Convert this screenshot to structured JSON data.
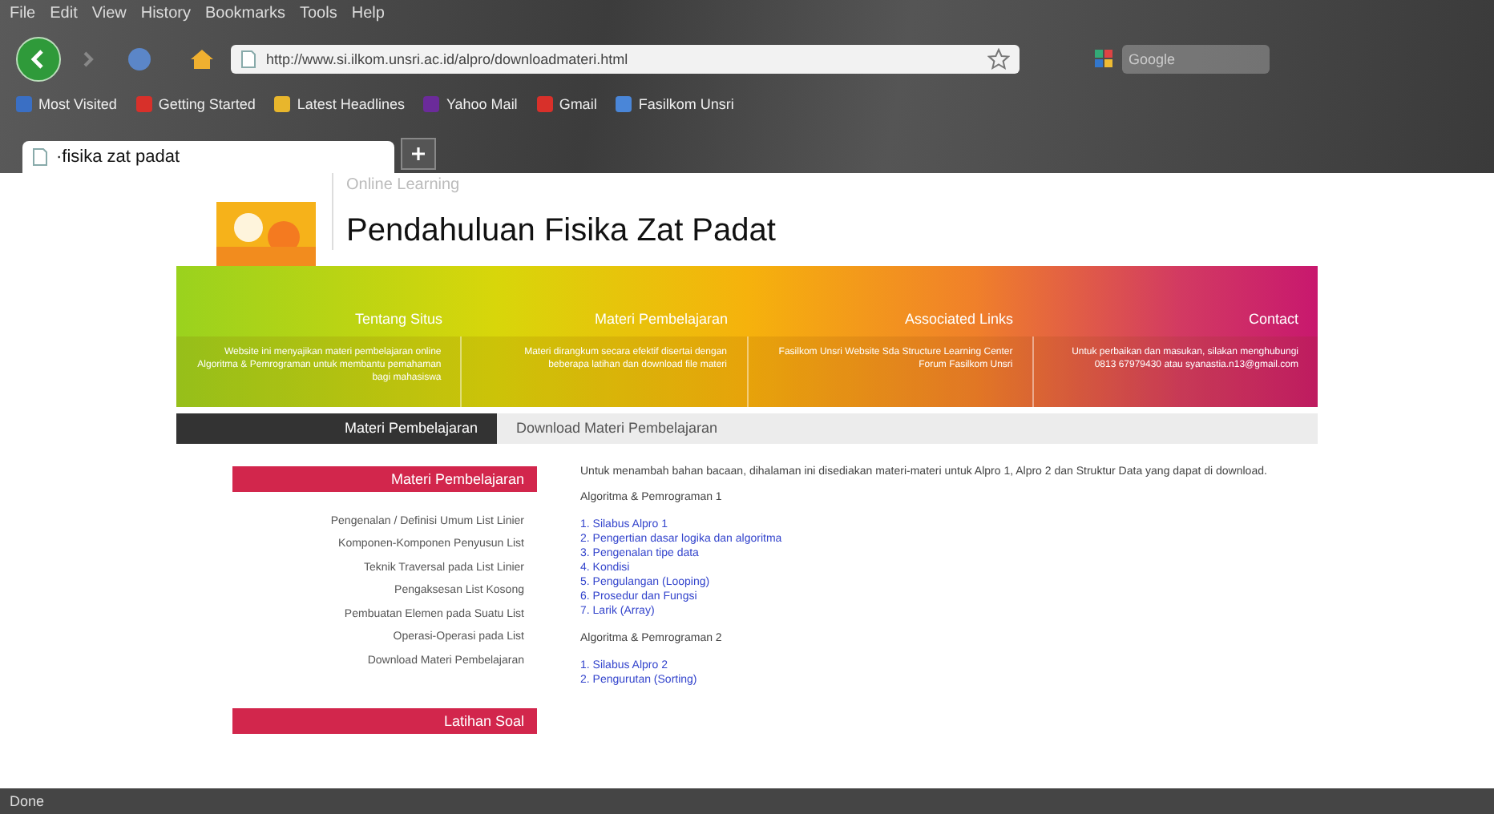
{
  "menu": [
    "File",
    "Edit",
    "View",
    "History",
    "Bookmarks",
    "Tools",
    "Help"
  ],
  "address": "http://www.si.ilkom.unsri.ac.id/alpro/downloadmateri.html",
  "search": {
    "placeholder": "Google"
  },
  "bookmarks": [
    {
      "label": "Most Visited",
      "color": "#3a6fc4"
    },
    {
      "label": "Getting Started",
      "color": "#d8302a"
    },
    {
      "label": "Latest Headlines",
      "color": "#e8b62c"
    },
    {
      "label": "Yahoo Mail",
      "color": "#6b2b9a"
    },
    {
      "label": "Gmail",
      "color": "#d8302a"
    },
    {
      "label": "Fasilkom Unsri",
      "color": "#4a86d8"
    }
  ],
  "tabs": [
    {
      "label": "·fisika zat padat",
      "selected": true
    }
  ],
  "page": {
    "tagline": "Online Learning",
    "title": "Pendahuluan Fisika Zat Padat",
    "banner": [
      {
        "title": "Tentang Situs",
        "text": "Website ini menyajikan materi pembelajaran online Algoritma & Pemrograman untuk membantu pemahaman bagi mahasiswa"
      },
      {
        "title": "Materi Pembelajaran",
        "text": "Materi dirangkum secara efektif disertai dengan beberapa latihan dan download file materi"
      },
      {
        "title": "Associated Links",
        "text": "Fasilkom Unsri Website Sda Structure Learning Center Forum Fasilkom Unsri"
      },
      {
        "title": "Contact",
        "text": "Untuk perbaikan dan masukan, silakan menghubungi 0813 67979430 atau syanastia.n13@gmail.com"
      }
    ],
    "subnav": [
      {
        "label": "Materi Pembelajaran",
        "selected": true
      },
      {
        "label": "Download Materi Pembelajaran",
        "selected": false
      }
    ],
    "sidebar": [
      {
        "heading": "Materi Pembelajaran",
        "items": [
          "Pengenalan / Definisi Umum List Linier",
          "Komponen-Komponen Penyusun List",
          "Teknik Traversal pada List Linier",
          "Pengaksesan List Kosong",
          "Pembuatan Elemen pada Suatu List",
          "Operasi-Operasi pada List",
          "Download Materi Pembelajaran"
        ]
      },
      {
        "heading": "Latihan Soal"
      }
    ],
    "intro": "Untuk menambah bahan bacaan, dihalaman ini disediakan materi-materi untuk Alpro 1, Alpro 2 dan Struktur Data yang dapat di download.",
    "sections": [
      {
        "heading": "Algoritma & Pemrograman 1",
        "links": [
          "1. Silabus Alpro 1",
          "2. Pengertian dasar logika dan algoritma",
          "3. Pengenalan tipe data",
          "4. Kondisi",
          "5. Pengulangan (Looping)",
          "6. Prosedur dan Fungsi",
          "7. Larik (Array)"
        ]
      },
      {
        "heading": "Algoritma & Pemrograman 2",
        "links": [
          "1. Silabus Alpro 2",
          "2. Pengurutan (Sorting)"
        ]
      }
    ]
  },
  "status_bar": "Done"
}
